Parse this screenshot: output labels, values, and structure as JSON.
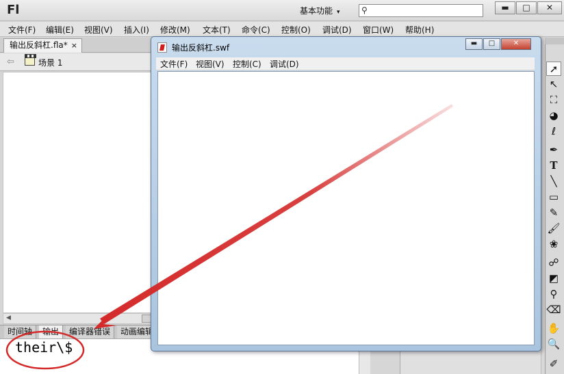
{
  "app": {
    "logo": "Fl",
    "workspace_label": "基本功能",
    "workspace_arrow": "▾",
    "search_placeholder": "",
    "minimize_glyph": "▬",
    "restore_glyph": "□",
    "close_glyph": "✕"
  },
  "menu": {
    "items": [
      "文件(F)",
      "编辑(E)",
      "视图(V)",
      "插入(I)",
      "修改(M)",
      "文本(T)",
      "命令(C)",
      "控制(O)",
      "调试(D)",
      "窗口(W)",
      "帮助(H)"
    ]
  },
  "document": {
    "tab_label": "输出反斜杠.fla*",
    "tab_close": "×",
    "scene_label": "场景 1"
  },
  "panel_tabs": [
    "时间轴",
    "输出",
    "编译器错误",
    "动画编辑器"
  ],
  "output": {
    "text": "their\\$"
  },
  "swf_window": {
    "title": "输出反斜杠.swf",
    "menu": [
      "文件(F)",
      "视图(V)",
      "控制(C)",
      "调试(D)"
    ]
  },
  "tools": [
    "selection-tool-icon",
    "subselection-tool-icon",
    "free-transform-tool-icon",
    "3d-rotation-tool-icon",
    "lasso-tool-icon",
    "pen-tool-icon",
    "text-tool-icon",
    "line-tool-icon",
    "rectangle-tool-icon",
    "pencil-tool-icon",
    "brush-tool-icon",
    "deco-tool-icon",
    "bone-tool-icon",
    "paint-bucket-tool-icon",
    "eyedropper-tool-icon",
    "eraser-tool-icon",
    "hand-tool-icon",
    "zoom-tool-icon",
    "stroke-color-icon"
  ],
  "colors": {
    "annotation": "#d42a2a",
    "swf_frame": "#b8cfe6"
  }
}
